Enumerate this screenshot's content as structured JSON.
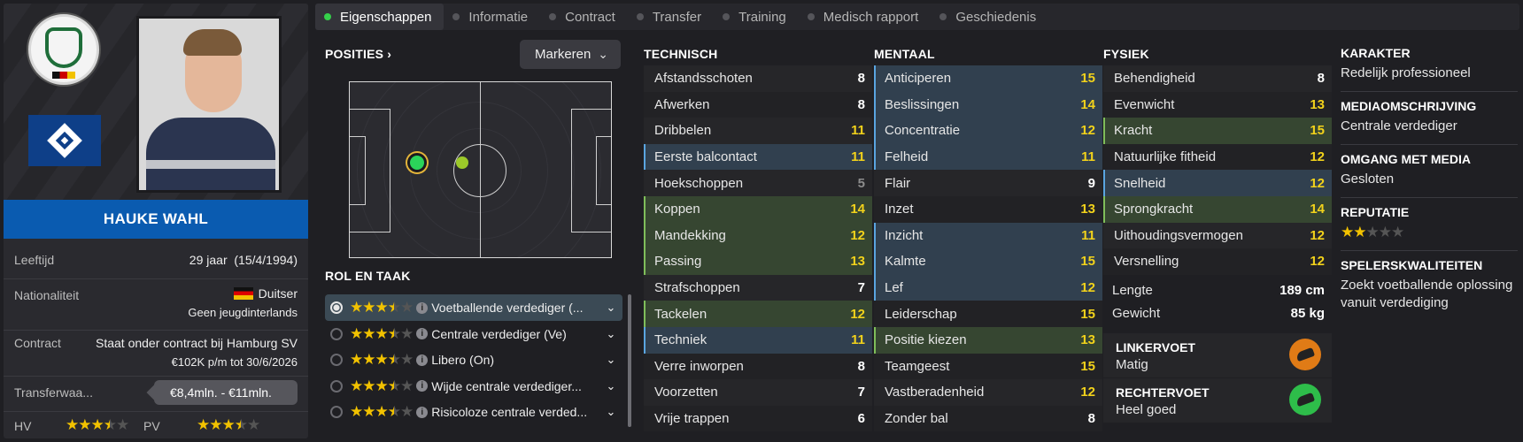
{
  "player": {
    "name": "HAUKE WAHL",
    "age_label": "Leeftijd",
    "age_value": "29 jaar  (15/4/1994)",
    "nationality_label": "Nationaliteit",
    "nationality_value": "Duitser",
    "nationality_sub": "Geen jeugdinterlands",
    "contract_label": "Contract",
    "contract_value": "Staat onder contract bij Hamburg SV",
    "contract_sub": "€102K p/m tot 30/6/2026",
    "transfer_label": "Transferwaa...",
    "transfer_value": "€8,4mln. - €11mln.",
    "ca_label": "HV",
    "pa_label": "PV",
    "ca_stars": 3.5,
    "pa_stars": 3.5
  },
  "tabs": [
    {
      "label": "Eigenschappen",
      "active": true
    },
    {
      "label": "Informatie"
    },
    {
      "label": "Contract"
    },
    {
      "label": "Transfer"
    },
    {
      "label": "Training"
    },
    {
      "label": "Medisch rapport"
    },
    {
      "label": "Geschiedenis"
    }
  ],
  "positions": {
    "title": "POSITIES",
    "title_icon": "chevron-right-icon",
    "highlight_button": "Markeren"
  },
  "roles": {
    "title": "ROL EN TAAK",
    "items": [
      {
        "stars": 3.5,
        "name": "Voetballende verdediger (...",
        "selected": true
      },
      {
        "stars": 3.5,
        "name": "Centrale verdediger (Ve)"
      },
      {
        "stars": 3.5,
        "name": "Libero (On)"
      },
      {
        "stars": 3.5,
        "name": "Wijde centrale verdediger..."
      },
      {
        "stars": 3.5,
        "name": "Risicoloze centrale verded..."
      }
    ]
  },
  "technical": {
    "title": "TECHNISCH",
    "attrs": [
      {
        "name": "Afstandsschoten",
        "value": "8",
        "tone": "w"
      },
      {
        "name": "Afwerken",
        "value": "8",
        "tone": "w"
      },
      {
        "name": "Dribbelen",
        "value": "11",
        "tone": "y"
      },
      {
        "name": "Eerste balcontact",
        "value": "11",
        "tone": "y",
        "hl": "b"
      },
      {
        "name": "Hoekschoppen",
        "value": "5",
        "tone": "gr"
      },
      {
        "name": "Koppen",
        "value": "14",
        "tone": "y",
        "hl": "g"
      },
      {
        "name": "Mandekking",
        "value": "12",
        "tone": "y",
        "hl": "g"
      },
      {
        "name": "Passing",
        "value": "13",
        "tone": "y",
        "hl": "g"
      },
      {
        "name": "Strafschoppen",
        "value": "7",
        "tone": "w"
      },
      {
        "name": "Tackelen",
        "value": "12",
        "tone": "y",
        "hl": "g"
      },
      {
        "name": "Techniek",
        "value": "11",
        "tone": "y",
        "hl": "b"
      },
      {
        "name": "Verre inworpen",
        "value": "8",
        "tone": "w"
      },
      {
        "name": "Voorzetten",
        "value": "7",
        "tone": "w"
      },
      {
        "name": "Vrije trappen",
        "value": "6",
        "tone": "w"
      }
    ]
  },
  "mental": {
    "title": "MENTAAL",
    "attrs": [
      {
        "name": "Anticiperen",
        "value": "15",
        "tone": "y",
        "hl": "b"
      },
      {
        "name": "Beslissingen",
        "value": "14",
        "tone": "y",
        "hl": "b"
      },
      {
        "name": "Concentratie",
        "value": "12",
        "tone": "y",
        "hl": "b"
      },
      {
        "name": "Felheid",
        "value": "11",
        "tone": "y",
        "hl": "b"
      },
      {
        "name": "Flair",
        "value": "9",
        "tone": "w"
      },
      {
        "name": "Inzet",
        "value": "13",
        "tone": "y"
      },
      {
        "name": "Inzicht",
        "value": "11",
        "tone": "y",
        "hl": "b"
      },
      {
        "name": "Kalmte",
        "value": "15",
        "tone": "y",
        "hl": "b"
      },
      {
        "name": "Lef",
        "value": "12",
        "tone": "y",
        "hl": "b"
      },
      {
        "name": "Leiderschap",
        "value": "15",
        "tone": "y"
      },
      {
        "name": "Positie kiezen",
        "value": "13",
        "tone": "y",
        "hl": "g"
      },
      {
        "name": "Teamgeest",
        "value": "15",
        "tone": "y"
      },
      {
        "name": "Vastberadenheid",
        "value": "12",
        "tone": "y"
      },
      {
        "name": "Zonder bal",
        "value": "8",
        "tone": "w"
      }
    ]
  },
  "physical": {
    "title": "FYSIEK",
    "attrs": [
      {
        "name": "Behendigheid",
        "value": "8",
        "tone": "w"
      },
      {
        "name": "Evenwicht",
        "value": "13",
        "tone": "y"
      },
      {
        "name": "Kracht",
        "value": "15",
        "tone": "y",
        "hl": "g"
      },
      {
        "name": "Natuurlijke fitheid",
        "value": "12",
        "tone": "y"
      },
      {
        "name": "Snelheid",
        "value": "12",
        "tone": "y",
        "hl": "b"
      },
      {
        "name": "Sprongkracht",
        "value": "14",
        "tone": "y",
        "hl": "g"
      },
      {
        "name": "Uithoudingsvermogen",
        "value": "12",
        "tone": "y"
      },
      {
        "name": "Versnelling",
        "value": "12",
        "tone": "y"
      }
    ],
    "length_label": "Lengte",
    "length_value": "189 cm",
    "weight_label": "Gewicht",
    "weight_value": "85 kg",
    "left_foot_label": "LINKERVOET",
    "left_foot_value": "Matig",
    "right_foot_label": "RECHTERVOET",
    "right_foot_value": "Heel goed"
  },
  "info": {
    "character_label": "KARAKTER",
    "character_value": "Redelijk professioneel",
    "media_desc_label": "MEDIAOMSCHRIJVING",
    "media_desc_value": "Centrale verdediger",
    "media_handling_label": "OMGANG MET MEDIA",
    "media_handling_value": "Gesloten",
    "reputation_label": "REPUTATIE",
    "reputation_stars": 2,
    "traits_label": "SPELERSKWALITEITEN",
    "traits_value": "Zoekt voetballende oplossing vanuit verdediging"
  },
  "colors": {
    "accent_blue": "#0a5bb0",
    "star": "#f2c200",
    "attr_yellow": "#f2d21b",
    "highlight_green": "#364631",
    "highlight_blue": "#31404f"
  }
}
